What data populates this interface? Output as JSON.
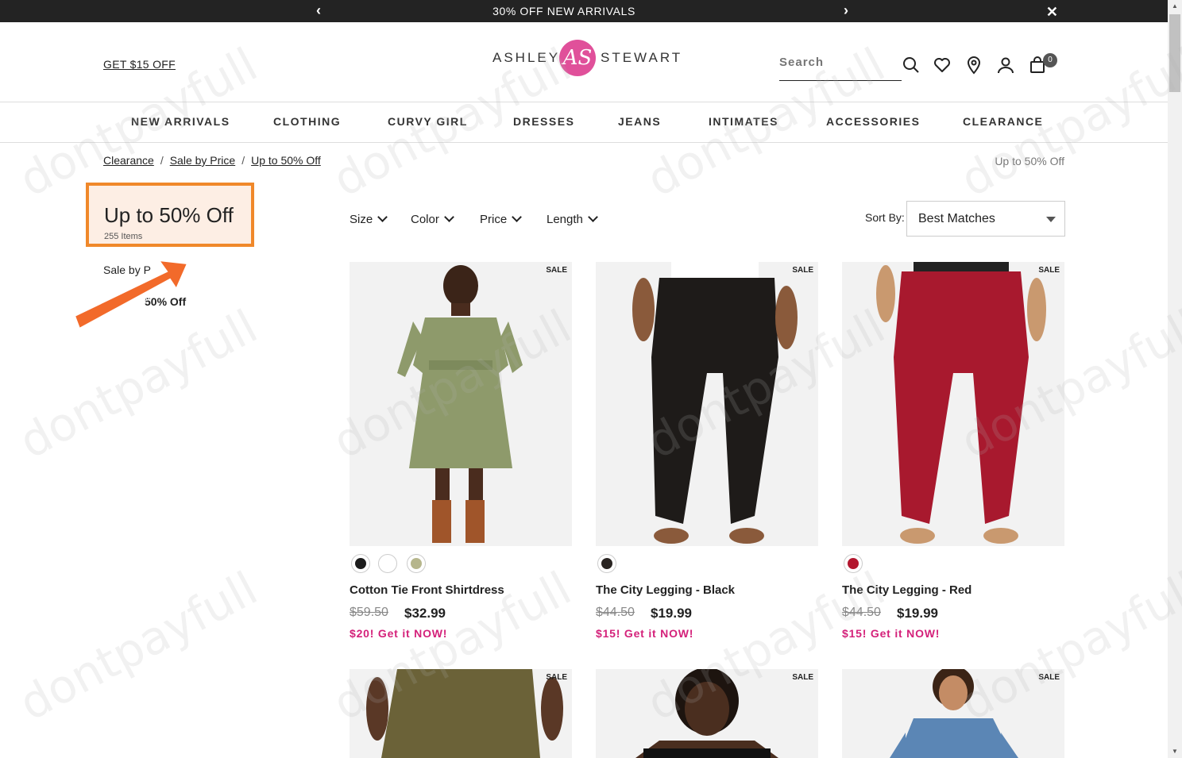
{
  "promo_bar": {
    "message": "30% OFF NEW ARRIVALS",
    "prev": "‹",
    "next": "›",
    "close": "✕"
  },
  "header": {
    "offer_link": "GET $15 OFF",
    "logo": {
      "left": "ASHLEY",
      "mark": "AS",
      "right": "STEWART"
    },
    "search_placeholder": "Search",
    "cart_count": "0"
  },
  "nav": [
    "NEW ARRIVALS",
    "CLOTHING",
    "CURVY GIRL",
    "DRESSES",
    "JEANS",
    "INTIMATES",
    "ACCESSORIES",
    "CLEARANCE"
  ],
  "breadcrumb": {
    "items": [
      "Clearance",
      "Sale by Price",
      "Up to 50% Off"
    ],
    "separator": "/",
    "right": "Up to 50% Off"
  },
  "category": {
    "title": "Up to 50% Off",
    "count": "255 Items",
    "parent_link": "Sale by P",
    "sub_link": "50% Off"
  },
  "watermark": {
    "ribbon": "dontpayfull",
    "tile": "dontpayfull"
  },
  "filters": {
    "size": "Size",
    "color": "Color",
    "price": "Price",
    "length": "Length"
  },
  "sort": {
    "label": "Sort By:",
    "value": "Best Matches"
  },
  "products": [
    {
      "badge": "SALE",
      "name": "Cotton Tie Front Shirtdress",
      "old_price": "$59.50",
      "price": "$32.99",
      "promo": "$20! Get it NOW!",
      "swatches": [
        "#1c1c1c",
        "#ffffff",
        "#b6b68c"
      ]
    },
    {
      "badge": "SALE",
      "name": "The City Legging - Black",
      "old_price": "$44.50",
      "price": "$19.99",
      "promo": "$15! Get it NOW!",
      "swatches": [
        "#2a2522"
      ]
    },
    {
      "badge": "SALE",
      "name": "The City Legging - Red",
      "old_price": "$44.50",
      "price": "$19.99",
      "promo": "$15! Get it NOW!",
      "swatches": [
        "#b3162e"
      ]
    },
    {
      "badge": "SALE"
    },
    {
      "badge": "SALE"
    },
    {
      "badge": "SALE"
    }
  ]
}
